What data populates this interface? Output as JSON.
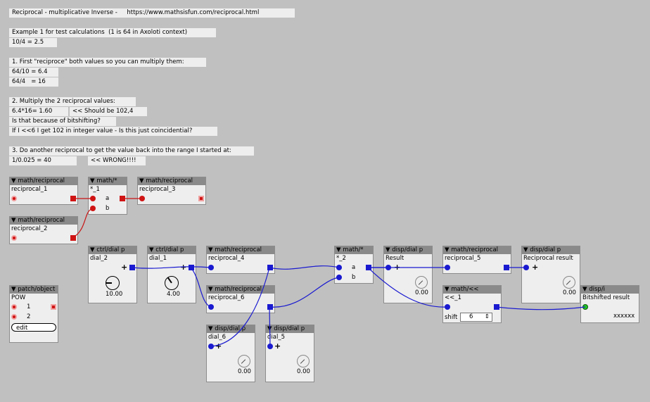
{
  "comments": {
    "c1": "Reciprocal - multiplicative Inverse -     https://www.mathsisfun.com/reciprocal.html",
    "c2": "Example 1 for test calculations  (1 is 64 in Axoloti context)",
    "c3": "10/4 = 2.5",
    "c4": "1. First \"reciproce\" both values so you can multiply them:",
    "c5": "64/10 = 6.4",
    "c6": "64/4   = 16",
    "c7": "2. Multiply the 2 reciprocal values:",
    "c8": "6.4*16= 1.60",
    "c9": "<< Should be 102,4",
    "c10": "Is that because of bitshifting?",
    "c11": "If I <<6 I get 102 in integer value - Is this just coincidential?",
    "c12": "3. Do another reciprocal to get the value back into the range I started at:",
    "c13": "1/0.025 = 40",
    "c14": "<< WRONG!!!!"
  },
  "objects": {
    "recip1": {
      "type": "▼ math/reciprocal",
      "name": "reciprocal_1"
    },
    "recip2": {
      "type": "▼ math/reciprocal",
      "name": "reciprocal_2"
    },
    "mul1": {
      "type": "▼ math/*",
      "name": "*_1",
      "in_a": "a",
      "in_b": "b"
    },
    "recip3": {
      "type": "▼ math/reciprocal",
      "name": "reciprocal_3"
    },
    "patch": {
      "type": "▼ patch/object",
      "name": "POW",
      "in1": "1",
      "in2": "2",
      "edit": "edit"
    },
    "dial2": {
      "type": "▼ ctrl/dial p",
      "name": "dial_2",
      "value": "10.00"
    },
    "dial1": {
      "type": "▼ ctrl/dial p",
      "name": "dial_1",
      "value": "4.00"
    },
    "recip4": {
      "type": "▼ math/reciprocal",
      "name": "reciprocal_4"
    },
    "recip6": {
      "type": "▼ math/reciprocal",
      "name": "reciprocal_6"
    },
    "disp6": {
      "type": "▼ disp/dial p",
      "name": "dial_6",
      "value": "0.00"
    },
    "disp5": {
      "type": "▼ disp/dial p",
      "name": "dial_5",
      "value": "0.00"
    },
    "mul2": {
      "type": "▼ math/*",
      "name": "*_2",
      "in_a": "a",
      "in_b": "b"
    },
    "result": {
      "type": "▼ disp/dial p",
      "name": "Result",
      "value": "0.00"
    },
    "recip5": {
      "type": "▼ math/reciprocal",
      "name": "reciprocal_5"
    },
    "shift": {
      "type": "▼ math/<<",
      "name": "<<_1",
      "param_label": "shift",
      "param_value": "6"
    },
    "recres": {
      "type": "▼ disp/dial p",
      "name": "Reciprocal result",
      "value": "0.00"
    },
    "dispi": {
      "type": "▼ disp/i",
      "name": "Bitshifted result",
      "value": "xxxxxx"
    }
  },
  "colors": {
    "canvas": "#c0c0c0",
    "wire_blue": "#1a1ad0",
    "wire_red": "#c81414",
    "header": "#8a8a8a",
    "box": "#eeeeee"
  },
  "icons": {
    "plus": "+",
    "spinner": "⇕"
  }
}
